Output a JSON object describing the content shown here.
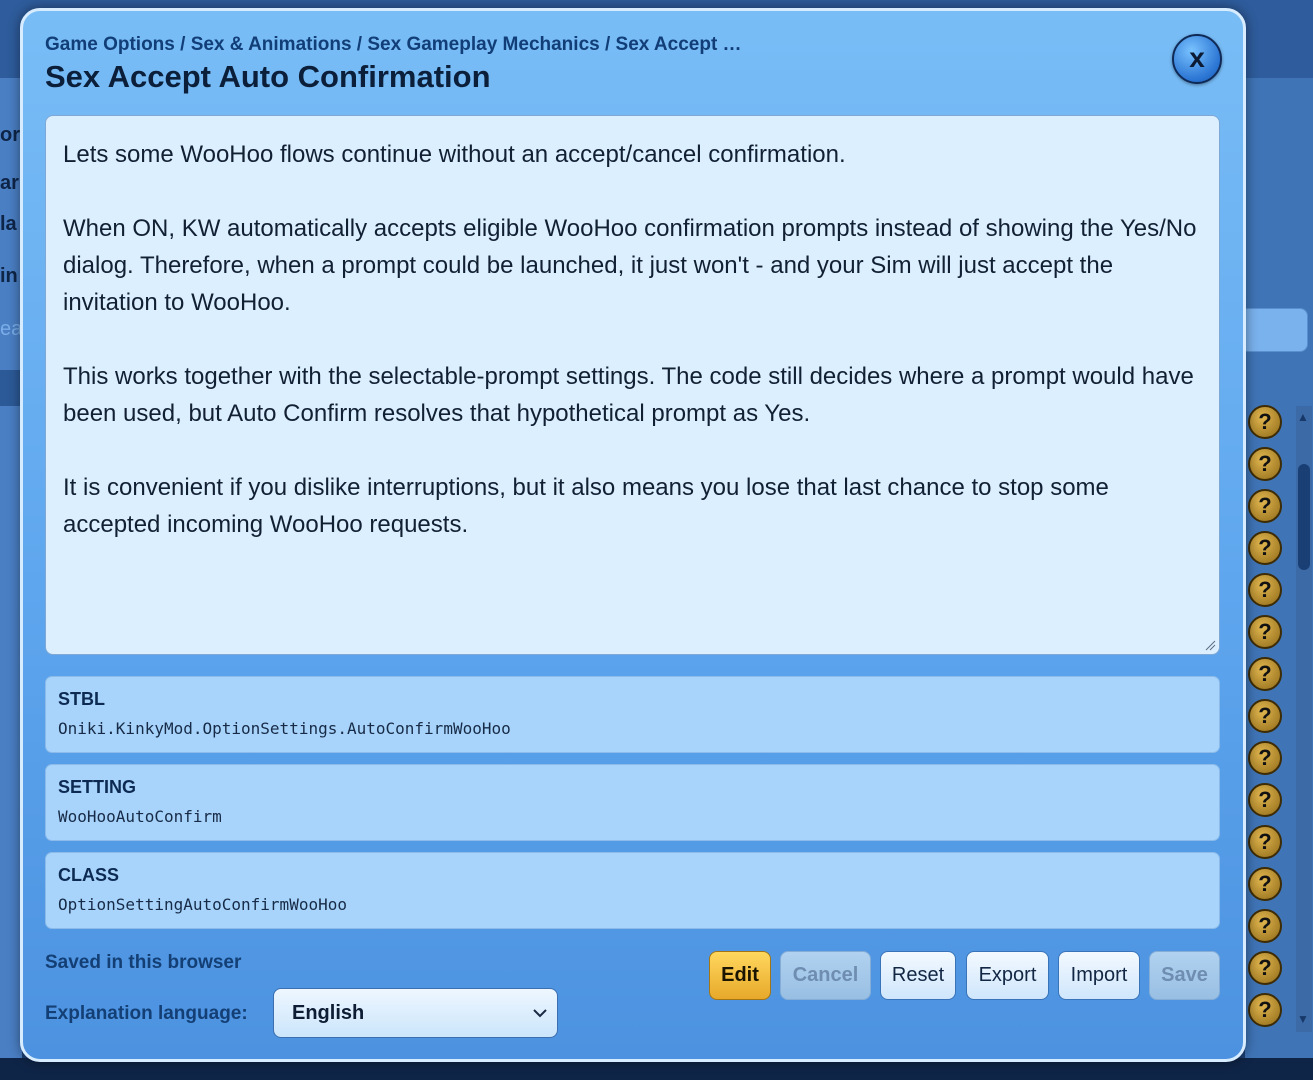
{
  "background": {
    "left_fragments": [
      "or",
      "ar",
      "la",
      "in",
      "ea"
    ],
    "help_label": "?"
  },
  "modal": {
    "breadcrumb": "Game Options / Sex & Animations / Sex Gameplay Mechanics / Sex Accept …",
    "title": "Sex Accept Auto Confirmation",
    "close_label": "x",
    "description": [
      "Lets some WooHoo flows continue without an accept/cancel confirmation.",
      "When ON, KW automatically accepts eligible WooHoo confirmation prompts instead of showing the Yes/No dialog. Therefore, when a prompt could be launched, it just won't - and your Sim will just accept the invitation to WooHoo.",
      "This works together with the selectable-prompt settings. The code still decides where a prompt would have been used, but Auto Confirm resolves that hypothetical prompt as Yes.",
      "It is convenient if you dislike interruptions, but it also means you lose that last chance to stop some accepted incoming WooHoo requests."
    ],
    "info": {
      "stbl": {
        "label": "STBL",
        "value": "Oniki.KinkyMod.OptionSettings.AutoConfirmWooHoo"
      },
      "setting": {
        "label": "SETTING",
        "value": "WooHooAutoConfirm"
      },
      "class": {
        "label": "CLASS",
        "value": "OptionSettingAutoConfirmWooHoo"
      }
    },
    "footer": {
      "saved_text": "Saved in this browser",
      "language_label": "Explanation language:",
      "language_selected": "English"
    },
    "buttons": {
      "edit": "Edit",
      "cancel": "Cancel",
      "reset": "Reset",
      "export": "Export",
      "import": "Import",
      "save": "Save"
    }
  },
  "colors": {
    "accent_edit": "#f0b93a",
    "modal_bg": "#6fb2f2",
    "help_icon": "#c9a13a"
  }
}
